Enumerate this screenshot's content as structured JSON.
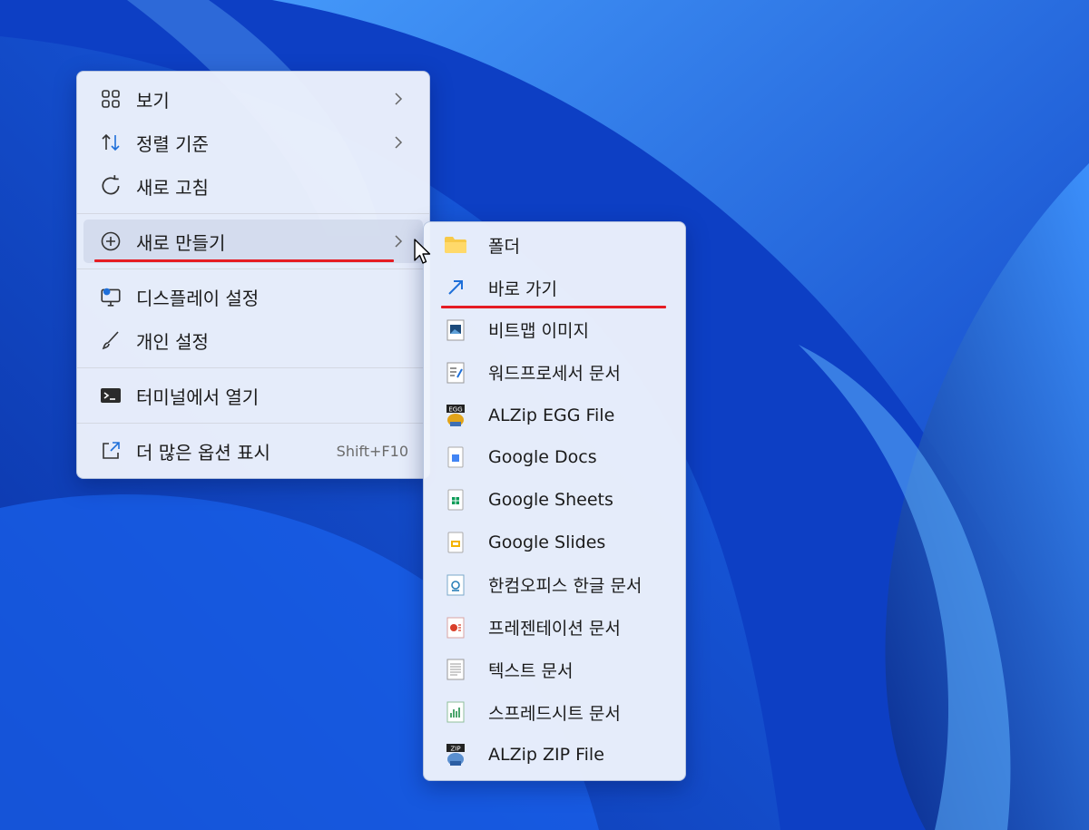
{
  "context_menu": {
    "items": [
      {
        "label": "보기",
        "icon": "grid-view-icon",
        "has_submenu": true
      },
      {
        "label": "정렬 기준",
        "icon": "sort-arrows-icon",
        "has_submenu": true
      },
      {
        "label": "새로 고침",
        "icon": "refresh-icon",
        "has_submenu": false
      },
      {
        "label": "새로 만들기",
        "icon": "plus-circle-icon",
        "has_submenu": true,
        "state": "hover"
      },
      {
        "label": "디스플레이 설정",
        "icon": "display-settings-icon",
        "has_submenu": false
      },
      {
        "label": "개인 설정",
        "icon": "brush-icon",
        "has_submenu": false
      },
      {
        "label": "터미널에서 열기",
        "icon": "terminal-icon",
        "has_submenu": false
      },
      {
        "label": "더 많은 옵션 표시",
        "icon": "more-options-icon",
        "shortcut": "Shift+F10"
      }
    ]
  },
  "new_submenu": {
    "items": [
      {
        "label": "폴더",
        "icon": "folder-icon"
      },
      {
        "label": "바로 가기",
        "icon": "shortcut-arrow-icon"
      },
      {
        "label": "비트맵 이미지",
        "icon": "bitmap-icon"
      },
      {
        "label": "워드프로세서 문서",
        "icon": "wordpad-icon"
      },
      {
        "label": "ALZip EGG File",
        "icon": "alzip-egg-icon"
      },
      {
        "label": "Google Docs",
        "icon": "google-docs-icon"
      },
      {
        "label": "Google Sheets",
        "icon": "google-sheets-icon"
      },
      {
        "label": "Google Slides",
        "icon": "google-slides-icon"
      },
      {
        "label": "한컴오피스 한글 문서",
        "icon": "hwp-document-icon"
      },
      {
        "label": "프레젠테이션 문서",
        "icon": "presentation-icon"
      },
      {
        "label": "텍스트 문서",
        "icon": "text-document-icon"
      },
      {
        "label": "스프레드시트 문서",
        "icon": "spreadsheet-icon"
      },
      {
        "label": "ALZip ZIP File",
        "icon": "alzip-zip-icon"
      }
    ]
  },
  "colors": {
    "underline": "#e51c23",
    "menu_bg": "#eef2fc",
    "hover_bg": "#d2daec"
  }
}
